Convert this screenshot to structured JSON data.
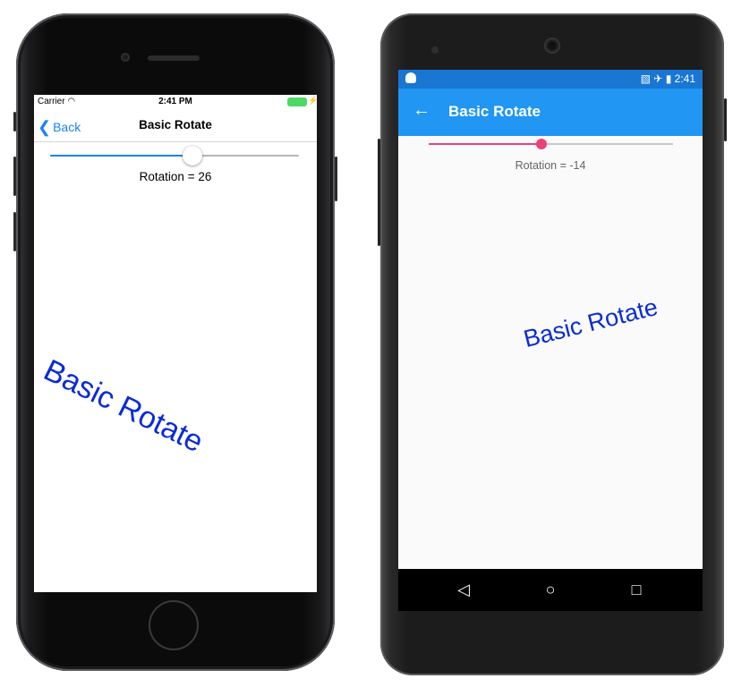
{
  "ios": {
    "status": {
      "carrier": "Carrier",
      "time": "2:41 PM"
    },
    "nav": {
      "back_label": "Back",
      "title": "Basic Rotate"
    },
    "slider": {
      "value": 26,
      "min": -180,
      "max": 180,
      "accent": "#1a82fb"
    },
    "rotation_label": "Rotation = 26",
    "rotated_text": "Basic Rotate",
    "rotated_text_color": "#0a2bd8"
  },
  "android": {
    "status": {
      "time": "2:41"
    },
    "appbar": {
      "title": "Basic Rotate",
      "color": "#2196f3",
      "status_color": "#1976d2"
    },
    "slider": {
      "value": -14,
      "min": -180,
      "max": 180,
      "accent": "#ec407a"
    },
    "rotation_label": "Rotation = -14",
    "rotated_text": "Basic Rotate",
    "rotated_text_color": "#0a2bd8",
    "navbar": {
      "back_icon": "triangle-back-icon",
      "home_icon": "circle-home-icon",
      "recents_icon": "square-recents-icon"
    }
  }
}
